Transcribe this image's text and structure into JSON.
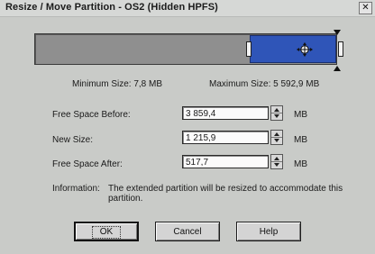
{
  "window": {
    "title": "Resize / Move Partition - OS2 (Hidden HPFS)",
    "close_glyph": "✕"
  },
  "partition_map": {
    "partition_color": "#2f55b8",
    "free_color": "#8f8f8f",
    "move_icon": "move-arrows-icon"
  },
  "sizes": {
    "minimum": "Minimum Size:  7,8 MB",
    "maximum": "Maximum Size:  5 592,9 MB"
  },
  "fields": {
    "free_before": {
      "label": "Free Space Before:",
      "value": "3 859,4",
      "unit": "MB"
    },
    "new_size": {
      "label": "New Size:",
      "value": "1 215,9",
      "unit": "MB"
    },
    "free_after": {
      "label": "Free Space After:",
      "value": "517,7",
      "unit": "MB"
    }
  },
  "information": {
    "label": "Information:",
    "text": "The extended partition will be resized to accommodate this partition."
  },
  "buttons": {
    "ok": "OK",
    "cancel": "Cancel",
    "help": "Help"
  }
}
